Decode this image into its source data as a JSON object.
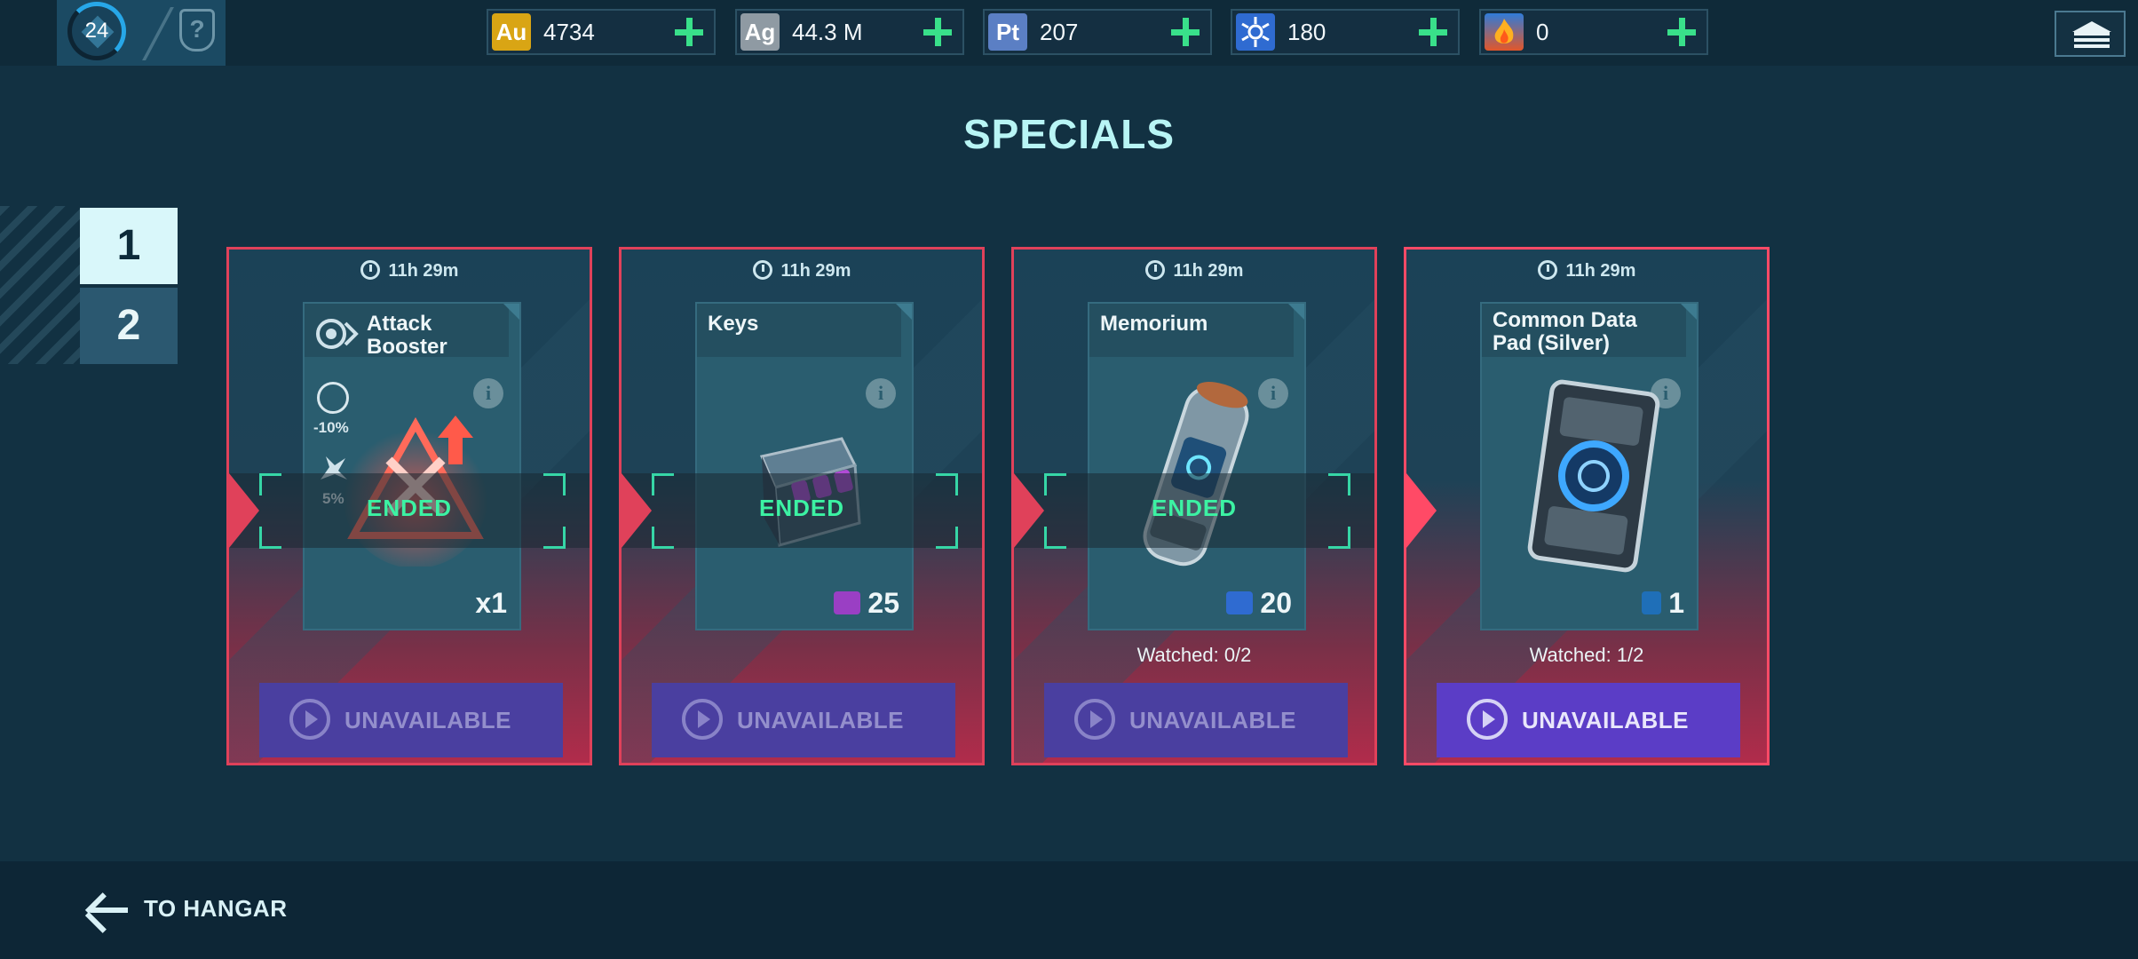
{
  "top": {
    "level": "24",
    "currencies": [
      {
        "code": "Au",
        "value": "4734",
        "color": "#d9a514",
        "icon": "gold-icon"
      },
      {
        "code": "Ag",
        "value": "44.3 M",
        "color": "#8f9aa3",
        "icon": "silver-icon"
      },
      {
        "code": "Pt",
        "value": "207",
        "color": "#5b7fc4",
        "icon": "platinum-icon"
      },
      {
        "code": "",
        "value": "180",
        "color": "#2f6bd1",
        "icon": "crew-token-icon"
      },
      {
        "code": "",
        "value": "0",
        "color": "#e2572a",
        "icon": "fire-icon"
      }
    ]
  },
  "title": "SPECIALS",
  "pages": [
    "1",
    "2"
  ],
  "active_page": "1",
  "cards": [
    {
      "timer": "11h 29m",
      "name": "Attack Booster",
      "stats": [
        "-10%",
        "5%"
      ],
      "quantity": "x1",
      "status": "ENDED",
      "watched": "",
      "button": "UNAVAILABLE"
    },
    {
      "timer": "11h 29m",
      "name": "Keys",
      "quantity": "25",
      "quantity_icon": "key-icon",
      "status": "ENDED",
      "watched": "",
      "button": "UNAVAILABLE"
    },
    {
      "timer": "11h 29m",
      "name": "Memorium",
      "quantity": "20",
      "quantity_icon": "crew-token-icon",
      "status": "ENDED",
      "watched": "Watched: 0/2",
      "button": "UNAVAILABLE"
    },
    {
      "timer": "11h 29m",
      "name": "Common Data Pad (Silver)",
      "quantity": "1",
      "quantity_icon": "data-pad-icon",
      "status": "",
      "watched": "Watched: 1/2",
      "button": "UNAVAILABLE"
    }
  ],
  "footer": {
    "back_label": "TO HANGAR"
  },
  "colors": {
    "accent": "#3cf2a3",
    "border": "#e0415a",
    "button": "#4a3fa0",
    "title": "#b8f5f5"
  }
}
